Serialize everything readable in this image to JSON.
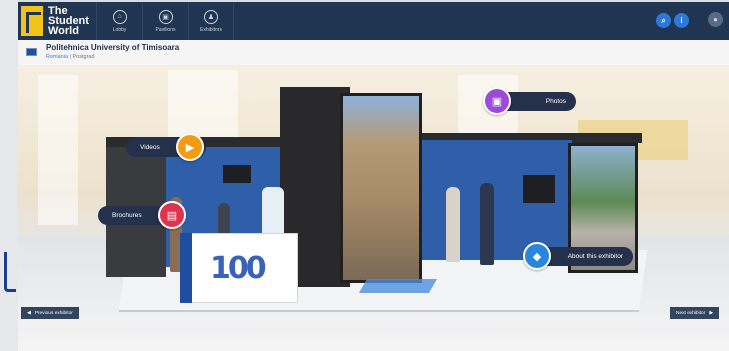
{
  "brand": {
    "line1": "The",
    "line2": "Student",
    "line3": "World"
  },
  "nav": {
    "tabs": [
      {
        "label": "Lobby",
        "icon": "home-icon"
      },
      {
        "label": "Pavilions",
        "icon": "pavilion-icon"
      },
      {
        "label": "Exhibitors",
        "icon": "exhibitor-icon"
      }
    ]
  },
  "exhibitor": {
    "name": "Politehnica University of Timisoara",
    "country": "Romania",
    "separator": "|",
    "level": "Postgrad"
  },
  "hotspots": {
    "photos": "Photos",
    "videos": "Videos",
    "brochures": "Brochures",
    "about": "About this exhibitor"
  },
  "desk_logo": "100",
  "footer": {
    "previous": "Previous exhibitor",
    "next": "Next exhibitor"
  },
  "colors": {
    "nav_bg": "#1f3551",
    "brand_yellow": "#f2c318",
    "photos_accent": "#9b4bd6",
    "videos_accent": "#f59b12",
    "brochures_accent": "#e0344e",
    "about_accent": "#2a86dc",
    "booth_blue": "#2f5fa8"
  }
}
